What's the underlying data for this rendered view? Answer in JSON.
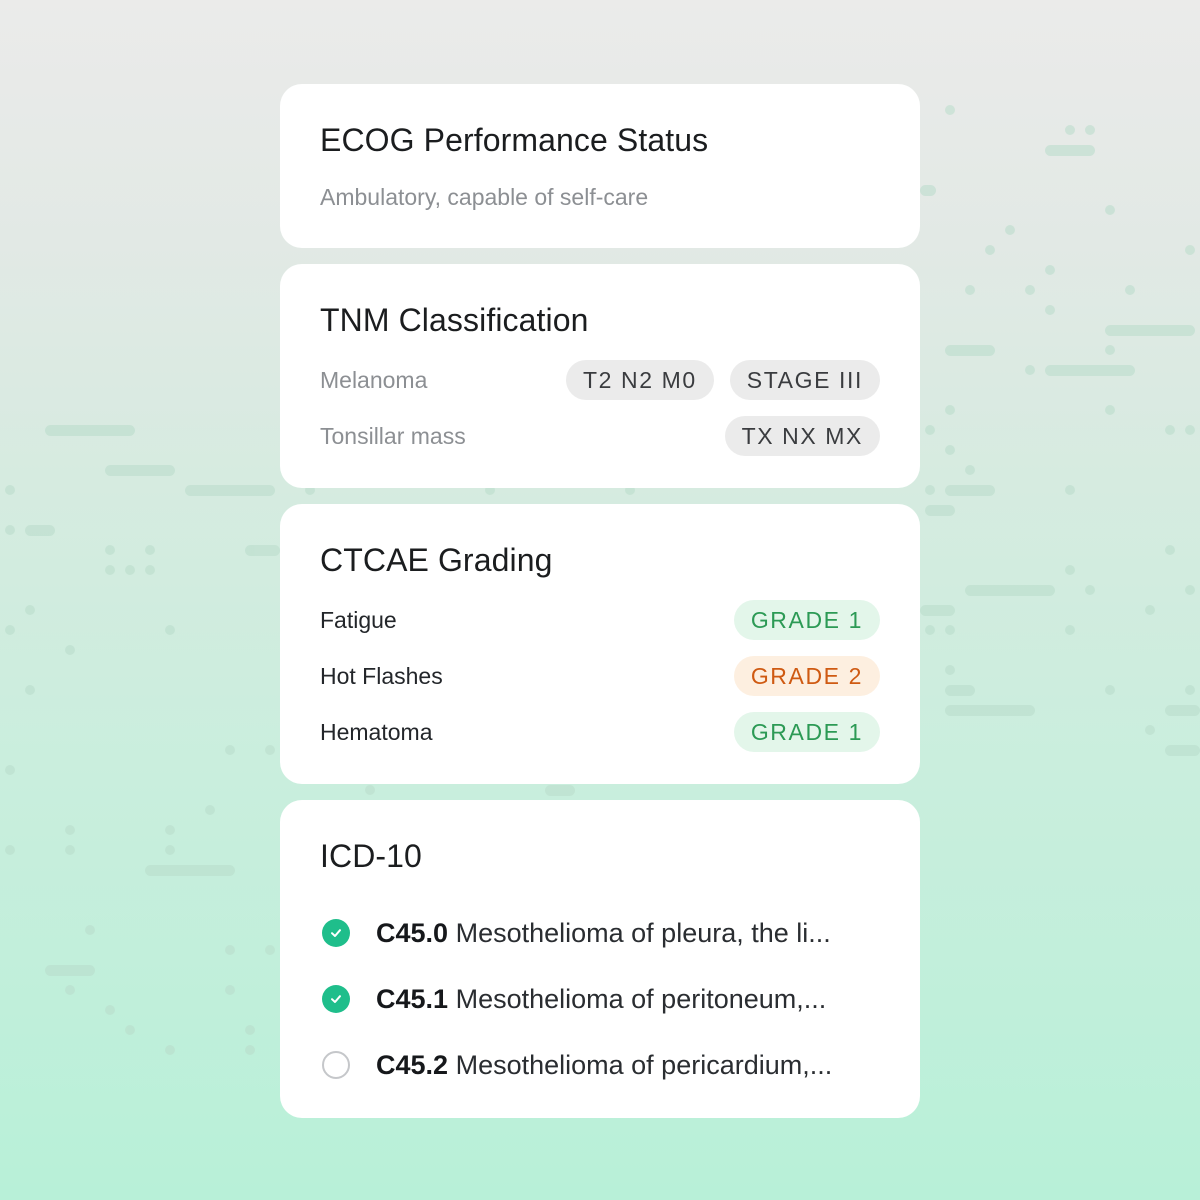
{
  "ecog": {
    "title": "ECOG Performance Status",
    "subtitle": "Ambulatory, capable of self-care"
  },
  "tnm": {
    "title": "TNM Classification",
    "rows": [
      {
        "label": "Melanoma",
        "tags": [
          "T2 N2 M0",
          "STAGE III"
        ]
      },
      {
        "label": "Tonsillar mass",
        "tags": [
          "TX NX MX"
        ]
      }
    ]
  },
  "ctcae": {
    "title": "CTCAE Grading",
    "rows": [
      {
        "label": "Fatigue",
        "grade": "GRADE 1",
        "level": "green"
      },
      {
        "label": "Hot Flashes",
        "grade": "GRADE 2",
        "level": "orange"
      },
      {
        "label": "Hematoma",
        "grade": "GRADE 1",
        "level": "green"
      }
    ]
  },
  "icd": {
    "title": "ICD-10",
    "items": [
      {
        "code": "C45.0",
        "text": "Mesothelioma of pleura, the li...",
        "checked": true
      },
      {
        "code": "C45.1",
        "text": "Mesothelioma of peritoneum,...",
        "checked": true
      },
      {
        "code": "C45.2",
        "text": "Mesothelioma of pericardium,...",
        "checked": false
      }
    ]
  },
  "colors": {
    "check_on": "#1fbe8b",
    "grade_green": "#2c9a55",
    "grade_orange": "#cf5a12",
    "background_top": "#ebebea",
    "background_bottom": "#b8f0d8"
  },
  "icons": {
    "checked": "check-circle-filled",
    "unchecked": "circle-outline"
  }
}
